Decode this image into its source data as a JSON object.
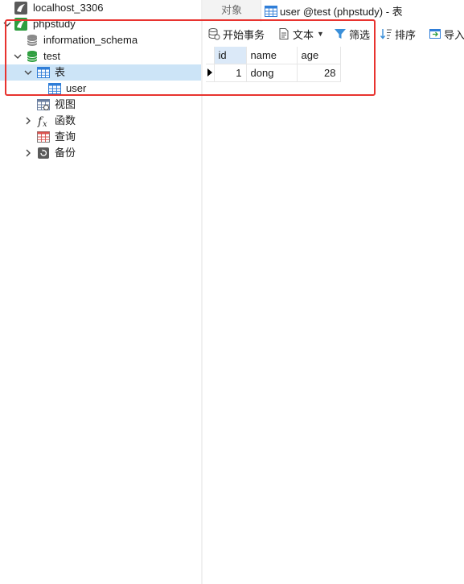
{
  "nav": {
    "connection_top": "localhost_3306",
    "connection": "phpstudy",
    "db_information_schema": "information_schema",
    "db_test": "test",
    "folder_tables": "表",
    "table_user": "user",
    "folder_views": "视图",
    "folder_functions": "函数",
    "folder_queries": "查询",
    "folder_backups": "备份"
  },
  "tabs": {
    "objects": "对象",
    "active": "user @test (phpstudy) - 表"
  },
  "toolbar": {
    "begin_transaction": "开始事务",
    "text": "文本",
    "filter": "筛选",
    "sort": "排序",
    "import": "导入"
  },
  "grid": {
    "columns": [
      "id",
      "name",
      "age"
    ],
    "rows": [
      [
        "1",
        "dong",
        "28"
      ]
    ]
  },
  "colors": {
    "highlight": "#e8332f",
    "selected_row": "#cce4f7",
    "db_active": "#2e9e3f",
    "db_inactive": "#8a8a8a",
    "table_icon": "#2f7ed8"
  }
}
